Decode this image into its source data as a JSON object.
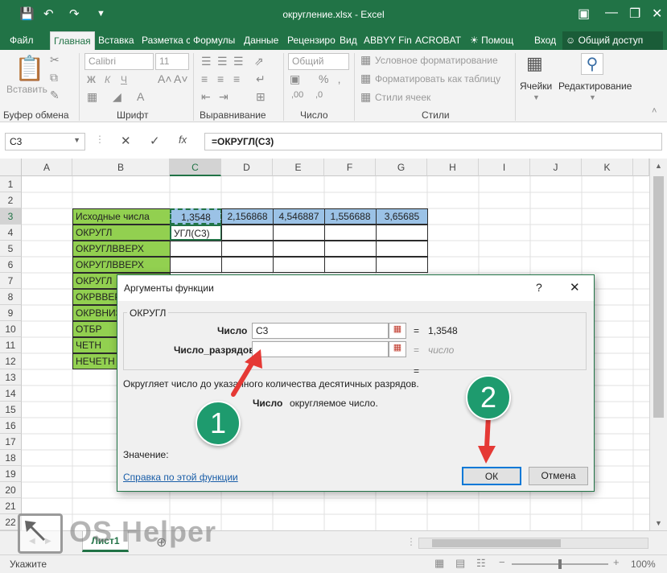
{
  "window": {
    "title": "округление.xlsx - Excel",
    "quick_icons": [
      "save-icon",
      "undo-icon",
      "redo-icon",
      "customize-icon"
    ],
    "controls": [
      "ribbon-options-icon",
      "minimize-icon",
      "restore-icon",
      "close-icon"
    ]
  },
  "tabs": [
    "Файл",
    "Главная",
    "Вставка",
    "Разметка с",
    "Формулы",
    "Данные",
    "Рецензиро",
    "Вид",
    "ABBYY Fin",
    "ACROBAT",
    "Помощ",
    "Вход",
    "Общий доступ"
  ],
  "ribbon": {
    "paste": "Вставить",
    "font_name": "Calibri",
    "font_size": "11",
    "number_format": "Общий",
    "cond_format": "Условное форматирование",
    "format_table": "Форматировать как таблицу",
    "cell_styles": "Стили ячеек",
    "cells": "Ячейки",
    "editing": "Редактирование",
    "groups": [
      "Буфер обмена",
      "Шрифт",
      "Выравнивание",
      "Число",
      "Стили"
    ],
    "bold": "Ж",
    "italic": "К",
    "underline": "Ч"
  },
  "formula_bar": {
    "name_box": "C3",
    "cancel": "✕",
    "enter": "✓",
    "fx": "fx",
    "formula": "=ОКРУГЛ(C3)"
  },
  "columns": [
    "A",
    "B",
    "C",
    "D",
    "E",
    "F",
    "G",
    "H",
    "I",
    "J",
    "K"
  ],
  "rows": [
    "1",
    "2",
    "3",
    "4",
    "5",
    "6",
    "7",
    "8",
    "9",
    "10",
    "11",
    "12",
    "13",
    "14",
    "15",
    "16",
    "17",
    "18",
    "19",
    "20",
    "21",
    "22"
  ],
  "cells": {
    "b3": "Исходные числа",
    "c3": "1,3548",
    "d3": "2,156868",
    "e3": "4,546887",
    "f3": "1,556688",
    "g3": "3,65685",
    "b4": "ОКРУГЛ",
    "c4": "УГЛ(C3)",
    "b5": "ОКРУГЛВВЕРХ",
    "b6": "ОКРУГЛВВЕРХ",
    "b7": "ОКРУГЛ",
    "b8": "ОКРВВЕРХ",
    "b9": "ОКРВНИЗ",
    "b10": "ОТБР",
    "b11": "ЧЕТН",
    "b12": "НЕЧЕТН"
  },
  "sheet": {
    "tab": "Лист1"
  },
  "status": {
    "mode": "Укажите",
    "zoom": "100%"
  },
  "watermark": "OS Helper",
  "dialog": {
    "title": "Аргументы функции",
    "help": "?",
    "close": "✕",
    "func": "ОКРУГЛ",
    "arg1_label": "Число",
    "arg1_value": "C3",
    "arg1_eq": "=",
    "arg1_result": "1,3548",
    "arg2_label": "Число_разрядов",
    "arg2_value": "",
    "arg2_eq": "=",
    "arg2_result": "число",
    "eq3": "=",
    "description": "Округляет число до указанного количества десятичных разрядов.",
    "param_name": "Число",
    "param_desc": "округляемое число.",
    "value_label": "Значение:",
    "help_link": "Справка по этой функции",
    "ok": "ОК",
    "cancel": "Отмена"
  },
  "annotations": {
    "circle1": "1",
    "circle2": "2",
    "color": "#1e9b6e",
    "arrow_color": "#e53935"
  }
}
